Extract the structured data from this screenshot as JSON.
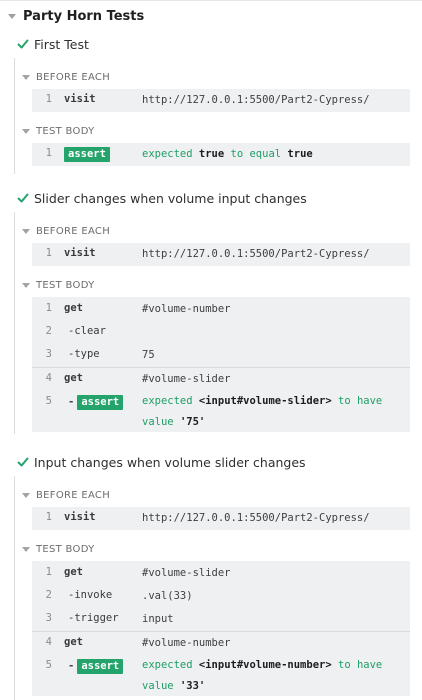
{
  "suite": {
    "title": "Party Horn Tests",
    "caret_icon": "caret-down-icon"
  },
  "colors": {
    "pass": "#24a36b",
    "block_bg": "#eef0f2",
    "assert_bg": "#24a36b"
  },
  "tests": [
    {
      "title": "First Test",
      "status_icon": "check-icon",
      "before_each": {
        "label": "BEFORE EACH",
        "commands": [
          {
            "num": "1",
            "name": "visit",
            "message": "http://127.0.0.1:5500/Part2-Cypress/"
          }
        ]
      },
      "test_body": {
        "label": "TEST BODY",
        "commands": [
          {
            "num": "1",
            "name": "assert",
            "m1": "expected ",
            "m2": "true",
            "m3": " to equal ",
            "m4": "true"
          }
        ]
      }
    },
    {
      "title": "Slider changes when volume input changes",
      "status_icon": "check-icon",
      "before_each": {
        "label": "BEFORE EACH",
        "commands": [
          {
            "num": "1",
            "name": "visit",
            "message": "http://127.0.0.1:5500/Part2-Cypress/"
          }
        ]
      },
      "test_body": {
        "label": "TEST BODY",
        "commands": [
          {
            "num": "1",
            "name": "get",
            "message": "#volume-number"
          },
          {
            "num": "2",
            "name": "-clear",
            "message": ""
          },
          {
            "num": "3",
            "name": "-type",
            "message": "75"
          },
          {
            "num": "4",
            "name": "get",
            "message": "#volume-slider"
          },
          {
            "num": "5",
            "name": "assert",
            "m1": "expected ",
            "m2": "<input#volume-slider>",
            "m3": " to have value ",
            "m4": "'75'"
          }
        ]
      }
    },
    {
      "title": "Input changes when volume slider changes",
      "status_icon": "check-icon",
      "before_each": {
        "label": "BEFORE EACH",
        "commands": [
          {
            "num": "1",
            "name": "visit",
            "message": "http://127.0.0.1:5500/Part2-Cypress/"
          }
        ]
      },
      "test_body": {
        "label": "TEST BODY",
        "commands": [
          {
            "num": "1",
            "name": "get",
            "message": "#volume-slider"
          },
          {
            "num": "2",
            "name": "-invoke",
            "message": ".val(33)"
          },
          {
            "num": "3",
            "name": "-trigger",
            "message": "input"
          },
          {
            "num": "4",
            "name": "get",
            "message": "#volume-number"
          },
          {
            "num": "5",
            "name": "assert",
            "m1": "expected ",
            "m2": "<input#volume-number>",
            "m3": " to have value ",
            "m4": "'33'"
          }
        ]
      }
    }
  ]
}
